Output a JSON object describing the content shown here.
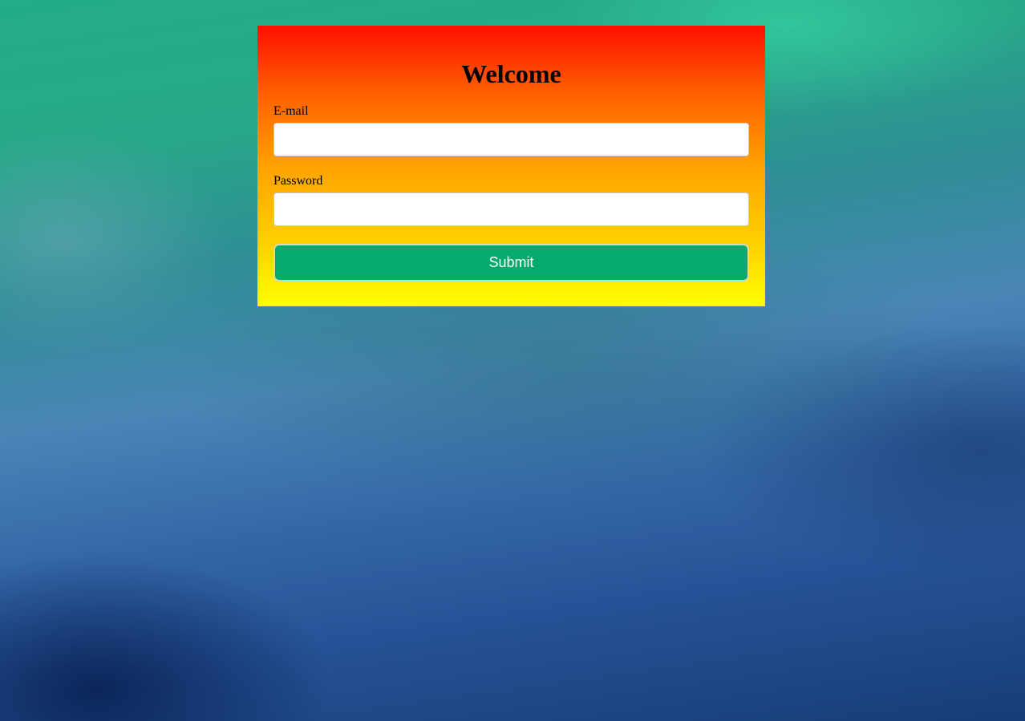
{
  "login": {
    "title": "Welcome",
    "email_label": "E-mail",
    "email_value": "",
    "password_label": "Password",
    "password_value": "",
    "submit_label": "Submit"
  },
  "colors": {
    "card_gradient_top": "#ff0d00",
    "card_gradient_bottom": "#ffff00",
    "submit_background": "#05aa6d",
    "submit_text": "#ffffff"
  }
}
